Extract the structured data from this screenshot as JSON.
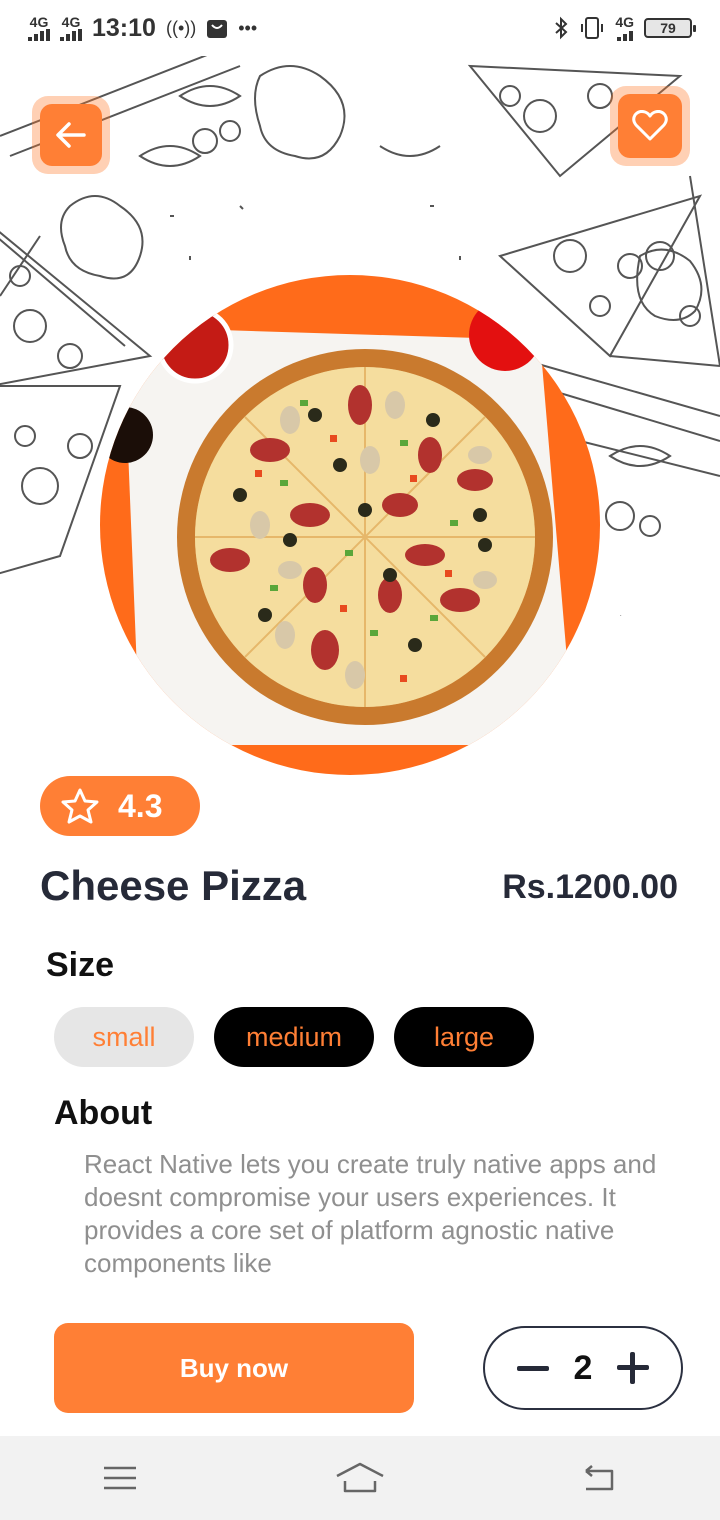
{
  "status_bar": {
    "net1": "4G",
    "net2": "4G",
    "time": "13:10",
    "net3": "4G",
    "battery": "79"
  },
  "product": {
    "rating": "4.3",
    "name": "Cheese Pizza",
    "price": "Rs.1200.00"
  },
  "size": {
    "label": "Size",
    "options": [
      "small",
      "medium",
      "large"
    ],
    "selected": "small"
  },
  "about": {
    "label": "About",
    "text": "React Native lets you create truly native apps and doesnt compromise your users experiences. It provides a core set of platform agnostic native components like"
  },
  "actions": {
    "buy_label": "Buy now",
    "quantity": "2"
  },
  "colors": {
    "accent": "#ff7f35",
    "text_dark": "#262a38",
    "muted": "#8f8f8f"
  },
  "icons": {
    "back": "arrow-left-icon",
    "favorite": "heart-icon",
    "rating": "star-icon"
  }
}
